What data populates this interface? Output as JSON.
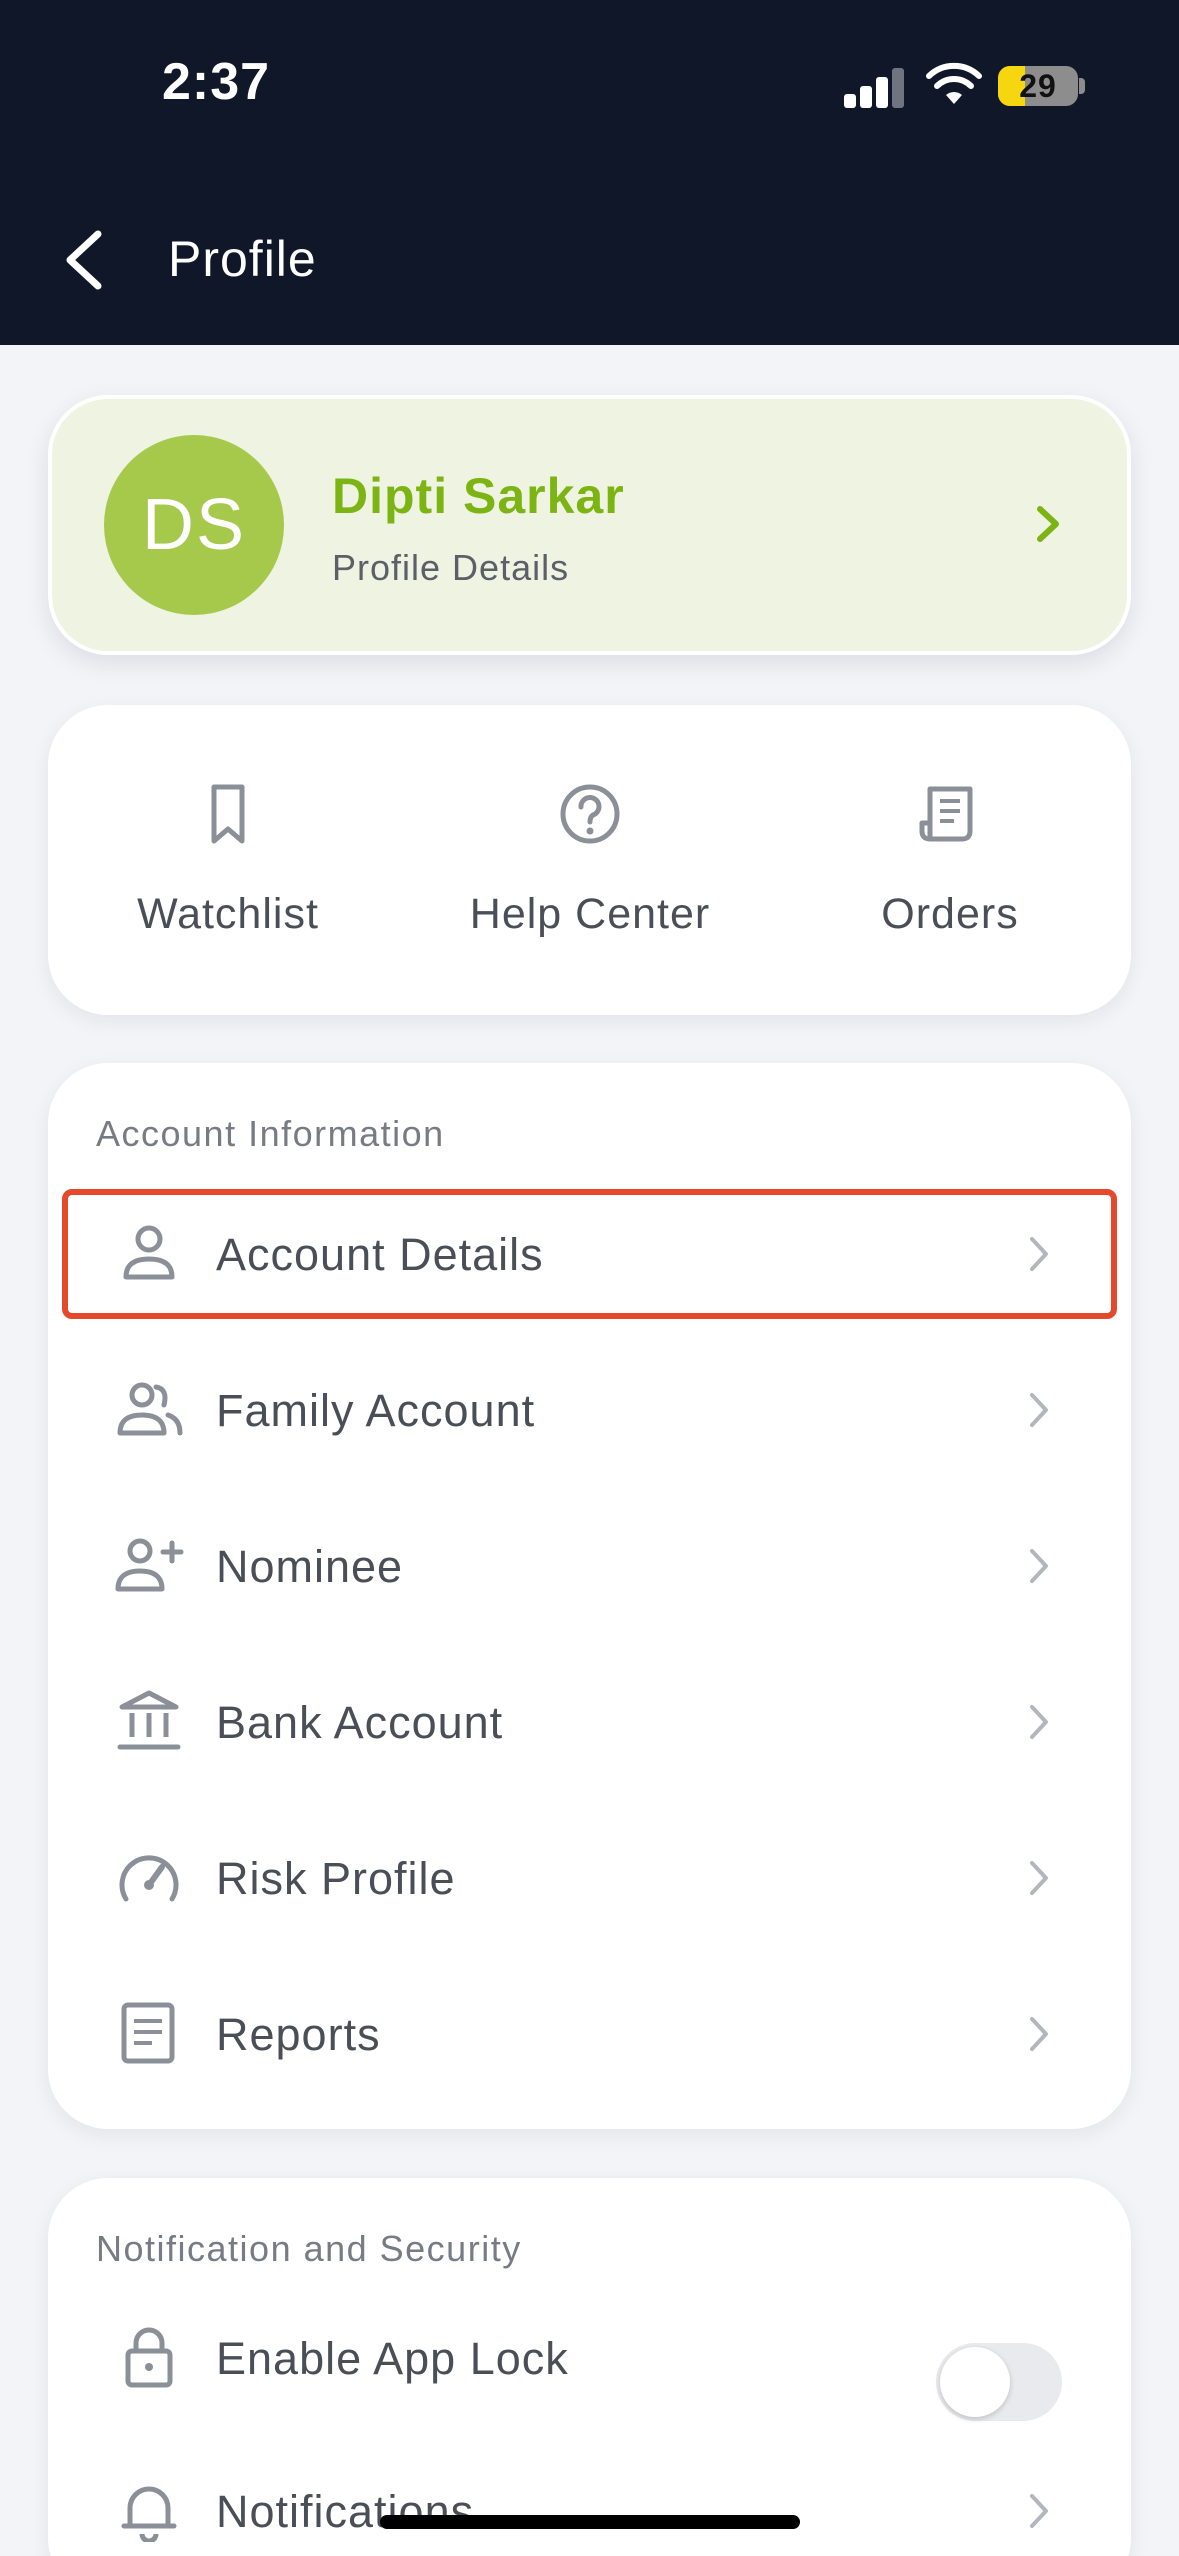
{
  "status_bar": {
    "time": "2:37",
    "battery": "29"
  },
  "header": {
    "title": "Profile"
  },
  "profile": {
    "initials": "DS",
    "name": "Dipti Sarkar",
    "subtitle": "Profile Details",
    "accent": "#7cb513",
    "avatar_color": "#a6c94c"
  },
  "quick_actions": [
    {
      "label": "Watchlist",
      "icon": "bookmark-icon"
    },
    {
      "label": "Help Center",
      "icon": "help-circle-icon"
    },
    {
      "label": "Orders",
      "icon": "receipt-icon"
    }
  ],
  "account_info": {
    "title": "Account Information",
    "items": [
      {
        "label": "Account Details",
        "icon": "user-icon",
        "highlighted": true
      },
      {
        "label": "Family Account",
        "icon": "users-icon"
      },
      {
        "label": "Nominee",
        "icon": "user-plus-icon"
      },
      {
        "label": "Bank Account",
        "icon": "bank-icon"
      },
      {
        "label": "Risk Profile",
        "icon": "gauge-icon"
      },
      {
        "label": "Reports",
        "icon": "document-icon"
      }
    ]
  },
  "notification_security": {
    "title": "Notification and Security",
    "items": [
      {
        "label": "Enable App Lock",
        "icon": "lock-icon",
        "toggle": false
      },
      {
        "label": "Notifications",
        "icon": "bell-icon"
      }
    ]
  },
  "colors": {
    "header_bg": "#0f1729",
    "highlight_border": "#e5492b",
    "page_bg": "#f2f4f7"
  }
}
